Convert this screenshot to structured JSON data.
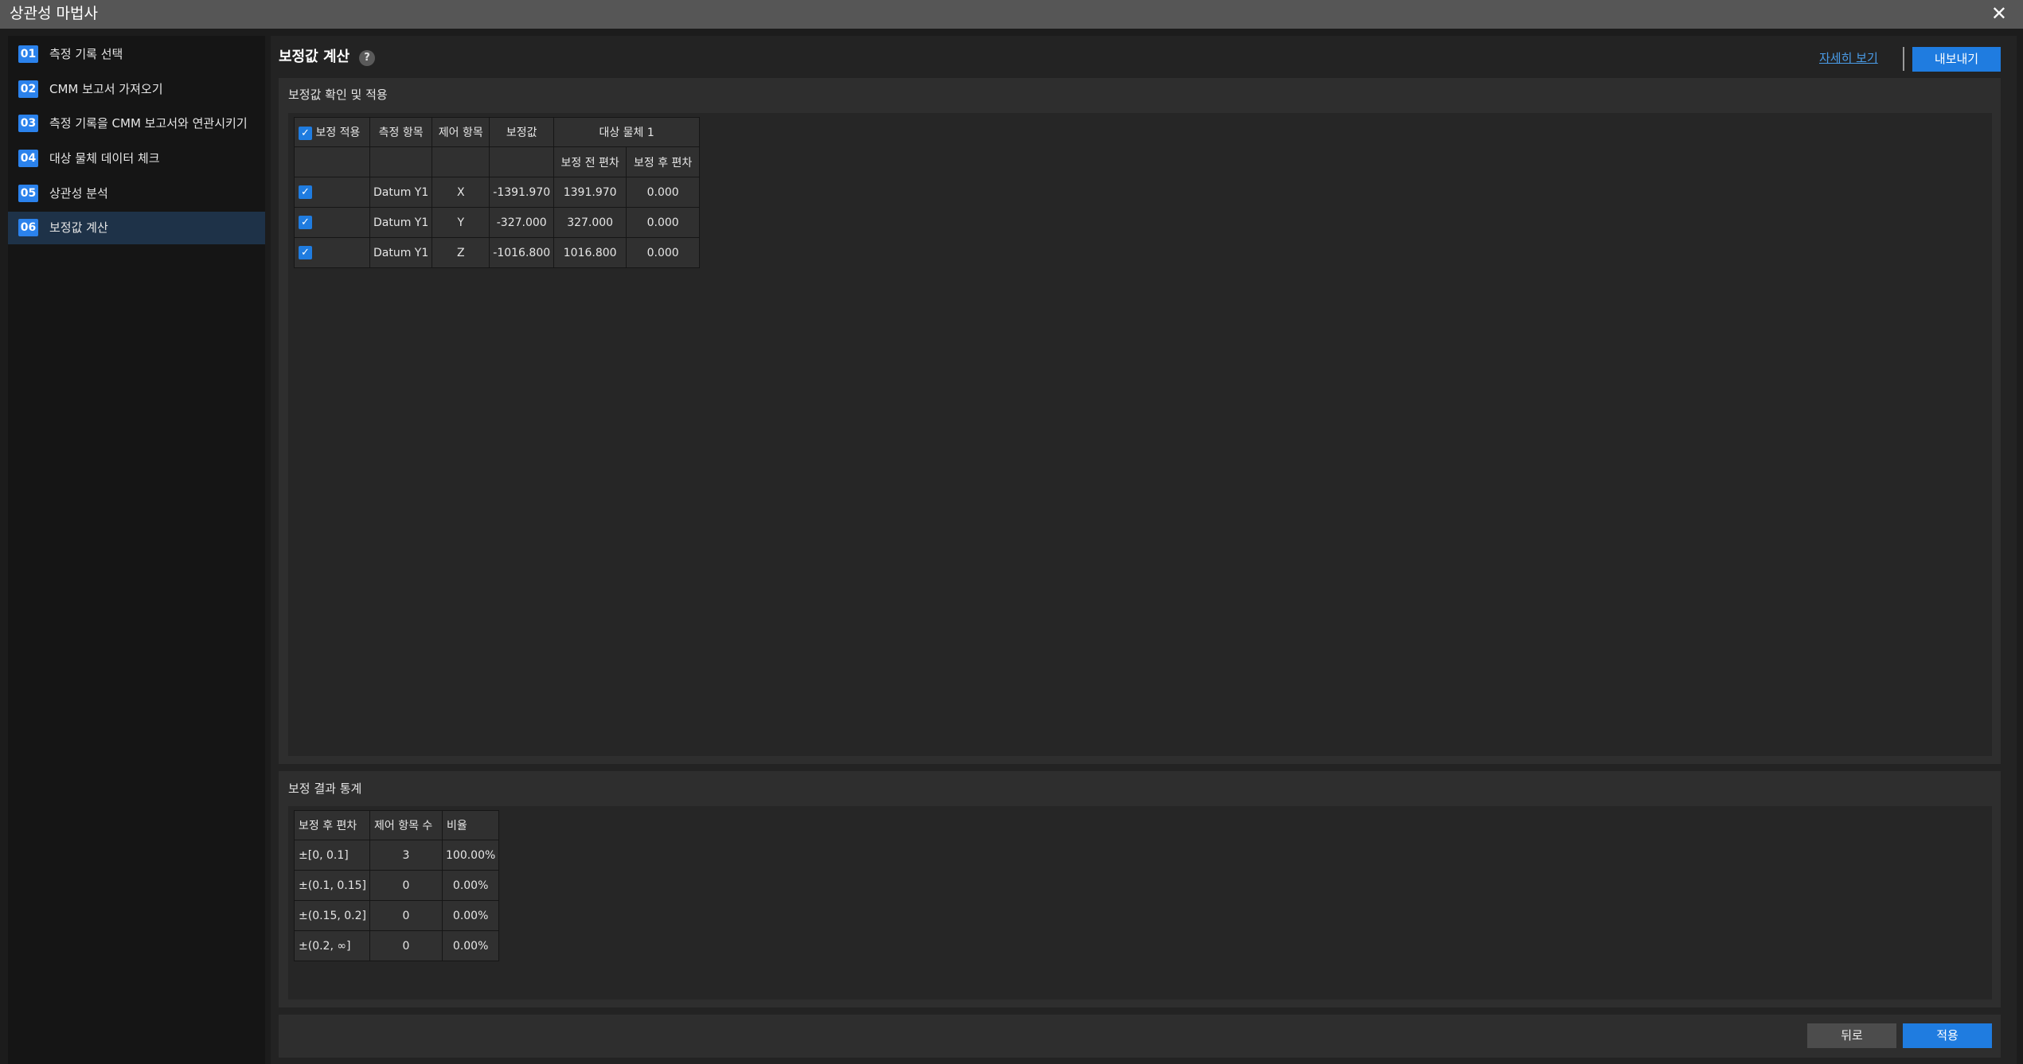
{
  "window": {
    "title": "상관성 마법사"
  },
  "sidebar": {
    "steps": [
      {
        "num": "01",
        "label": "측정 기록 선택"
      },
      {
        "num": "02",
        "label": "CMM 보고서 가져오기"
      },
      {
        "num": "03",
        "label": "측정 기록을 CMM 보고서와 연관시키기"
      },
      {
        "num": "04",
        "label": "대상 물체 데이터 체크"
      },
      {
        "num": "05",
        "label": "상관성 분석"
      },
      {
        "num": "06",
        "label": "보정값 계산"
      }
    ],
    "active_index": 5
  },
  "header": {
    "title": "보정값 계산",
    "help": "?",
    "detail_link": "자세히 보기",
    "export_label": "내보내기"
  },
  "check_panel": {
    "title": "보정값 확인 및 적용",
    "headers": {
      "apply": "보정 적용",
      "item": "측정 항목",
      "control": "제어 항목",
      "value": "보정값",
      "target": "대상 물체 1",
      "before": "보정 전 편차",
      "after": "보정 후 편차"
    },
    "rows": [
      {
        "checked": true,
        "item": "Datum Y1",
        "control": "X",
        "value": "-1391.970",
        "before": "1391.970",
        "after": "0.000"
      },
      {
        "checked": true,
        "item": "Datum Y1",
        "control": "Y",
        "value": "-327.000",
        "before": "327.000",
        "after": "0.000"
      },
      {
        "checked": true,
        "item": "Datum Y1",
        "control": "Z",
        "value": "-1016.800",
        "before": "1016.800",
        "after": "0.000"
      }
    ]
  },
  "stats_panel": {
    "title": "보정 결과 통계",
    "headers": {
      "deviation": "보정 후 편차",
      "count": "제어 항목 수",
      "ratio": "비율"
    },
    "rows": [
      {
        "range": "±[0, 0.1]",
        "count": "3",
        "ratio": "100.00%"
      },
      {
        "range": "±(0.1, 0.15]",
        "count": "0",
        "ratio": "0.00%"
      },
      {
        "range": "±(0.15, 0.2]",
        "count": "0",
        "ratio": "0.00%"
      },
      {
        "range": "±(0.2, ∞]",
        "count": "0",
        "ratio": "0.00%"
      }
    ]
  },
  "footer": {
    "back_label": "뒤로",
    "apply_label": "적용"
  },
  "colors": {
    "accent": "#1f7ce0",
    "link": "#4a9ce8",
    "active_step_bg": "#1e3248"
  },
  "icons": {
    "close": "close-icon",
    "help": "help-icon",
    "check": "checkbox-checked-icon"
  }
}
